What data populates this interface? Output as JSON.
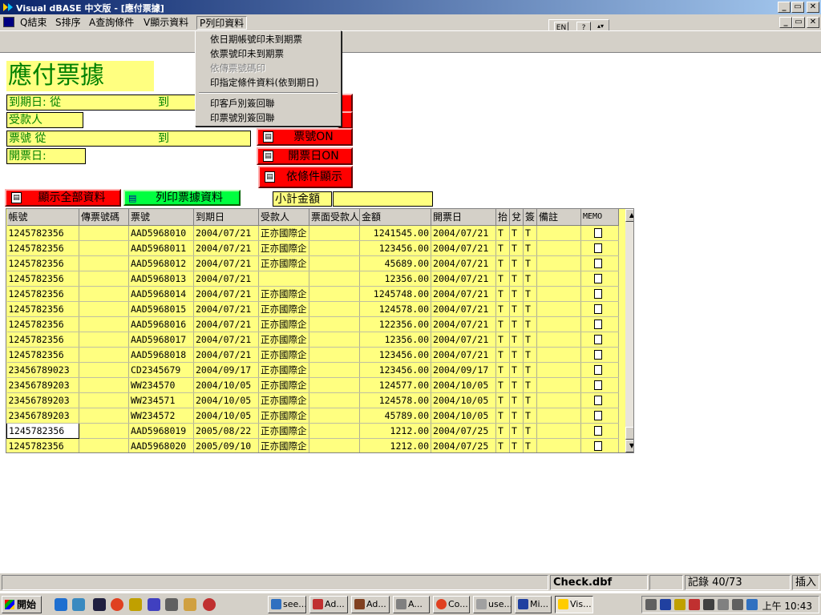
{
  "window": {
    "title": "Visual dBASE 中文版 - [應付票據]"
  },
  "menubar": {
    "items": [
      {
        "label": "Q結束"
      },
      {
        "label": "S排序"
      },
      {
        "label": "A查詢條件"
      },
      {
        "label": "V顯示資料"
      },
      {
        "label": "P列印資料"
      }
    ]
  },
  "toolbar": {
    "lang_btn": "EN",
    "help_btn": "?"
  },
  "print_menu": {
    "items": [
      {
        "label": "依日期帳號印未到期票",
        "enabled": true
      },
      {
        "label": "依票號印未到期票",
        "enabled": true
      },
      {
        "label": "依傳票號碼印",
        "enabled": false
      },
      {
        "label": "印指定條件資料(依到期日)",
        "enabled": true
      },
      {
        "label": "印客戶別簽回聯",
        "enabled": true
      },
      {
        "label": "印票號別簽回聯",
        "enabled": true
      }
    ]
  },
  "form": {
    "title": "應付票據",
    "due_date_label": "到期日: 從",
    "due_date_to": "到",
    "payee_label": "受款人",
    "ticket_no_label": "票號 從",
    "ticket_no_to": "到",
    "issue_date_label": "開票日:",
    "btn_ticket_on": "票號ON",
    "btn_issue_on": "開票日ON",
    "btn_by_condition": "依條件顯示",
    "btn_show_all": "顯示全部資料",
    "btn_print": "列印票據資料",
    "subtotal_label": "小計金額",
    "subtotal_value": ""
  },
  "grid": {
    "columns": [
      "帳號",
      "傳票號碼",
      "票號",
      "到期日",
      "受款人",
      "票面受款人",
      "金額",
      "開票日",
      "抬",
      "兌",
      "簽",
      "備註",
      "MEMO"
    ],
    "rows": [
      {
        "account": "1245782356",
        "voucher": "",
        "ticket": "AAD5968010",
        "due": "2004/07/21",
        "payee": "正亦國際企",
        "face_payee": "",
        "amount": "1241545.00",
        "issue": "2004/07/21",
        "a": "T",
        "b": "T",
        "c": "T",
        "note": ""
      },
      {
        "account": "1245782356",
        "voucher": "",
        "ticket": "AAD5968011",
        "due": "2004/07/21",
        "payee": "正亦國際企",
        "face_payee": "",
        "amount": "123456.00",
        "issue": "2004/07/21",
        "a": "T",
        "b": "T",
        "c": "T",
        "note": ""
      },
      {
        "account": "1245782356",
        "voucher": "",
        "ticket": "AAD5968012",
        "due": "2004/07/21",
        "payee": "正亦國際企",
        "face_payee": "",
        "amount": "45689.00",
        "issue": "2004/07/21",
        "a": "T",
        "b": "T",
        "c": "T",
        "note": ""
      },
      {
        "account": "1245782356",
        "voucher": "",
        "ticket": "AAD5968013",
        "due": "2004/07/21",
        "payee": "",
        "face_payee": "",
        "amount": "12356.00",
        "issue": "2004/07/21",
        "a": "T",
        "b": "T",
        "c": "T",
        "note": ""
      },
      {
        "account": "1245782356",
        "voucher": "",
        "ticket": "AAD5968014",
        "due": "2004/07/21",
        "payee": "正亦國際企",
        "face_payee": "",
        "amount": "1245748.00",
        "issue": "2004/07/21",
        "a": "T",
        "b": "T",
        "c": "T",
        "note": ""
      },
      {
        "account": "1245782356",
        "voucher": "",
        "ticket": "AAD5968015",
        "due": "2004/07/21",
        "payee": "正亦國際企",
        "face_payee": "",
        "amount": "124578.00",
        "issue": "2004/07/21",
        "a": "T",
        "b": "T",
        "c": "T",
        "note": ""
      },
      {
        "account": "1245782356",
        "voucher": "",
        "ticket": "AAD5968016",
        "due": "2004/07/21",
        "payee": "正亦國際企",
        "face_payee": "",
        "amount": "122356.00",
        "issue": "2004/07/21",
        "a": "T",
        "b": "T",
        "c": "T",
        "note": ""
      },
      {
        "account": "1245782356",
        "voucher": "",
        "ticket": "AAD5968017",
        "due": "2004/07/21",
        "payee": "正亦國際企",
        "face_payee": "",
        "amount": "12356.00",
        "issue": "2004/07/21",
        "a": "T",
        "b": "T",
        "c": "T",
        "note": ""
      },
      {
        "account": "1245782356",
        "voucher": "",
        "ticket": "AAD5968018",
        "due": "2004/07/21",
        "payee": "正亦國際企",
        "face_payee": "",
        "amount": "123456.00",
        "issue": "2004/07/21",
        "a": "T",
        "b": "T",
        "c": "T",
        "note": ""
      },
      {
        "account": "23456789023",
        "voucher": "",
        "ticket": "CD2345679",
        "due": "2004/09/17",
        "payee": "正亦國際企",
        "face_payee": "",
        "amount": "123456.00",
        "issue": "2004/09/17",
        "a": "T",
        "b": "T",
        "c": "T",
        "note": ""
      },
      {
        "account": "23456789203",
        "voucher": "",
        "ticket": "WW234570",
        "due": "2004/10/05",
        "payee": "正亦國際企",
        "face_payee": "",
        "amount": "124577.00",
        "issue": "2004/10/05",
        "a": "T",
        "b": "T",
        "c": "T",
        "note": ""
      },
      {
        "account": "23456789203",
        "voucher": "",
        "ticket": "WW234571",
        "due": "2004/10/05",
        "payee": "正亦國際企",
        "face_payee": "",
        "amount": "124578.00",
        "issue": "2004/10/05",
        "a": "T",
        "b": "T",
        "c": "T",
        "note": ""
      },
      {
        "account": "23456789203",
        "voucher": "",
        "ticket": "WW234572",
        "due": "2004/10/05",
        "payee": "正亦國際企",
        "face_payee": "",
        "amount": "45789.00",
        "issue": "2004/10/05",
        "a": "T",
        "b": "T",
        "c": "T",
        "note": ""
      },
      {
        "account": "1245782356",
        "voucher": "",
        "ticket": "AAD5968019",
        "due": "2005/08/22",
        "payee": "正亦國際企",
        "face_payee": "",
        "amount": "1212.00",
        "issue": "2004/07/25",
        "a": "T",
        "b": "T",
        "c": "T",
        "note": "",
        "selected": true
      },
      {
        "account": "1245782356",
        "voucher": "",
        "ticket": "AAD5968020",
        "due": "2005/09/10",
        "payee": "正亦國際企",
        "face_payee": "",
        "amount": "1212.00",
        "issue": "2004/07/25",
        "a": "T",
        "b": "T",
        "c": "T",
        "note": ""
      }
    ]
  },
  "statusbar": {
    "file": "Check.dbf",
    "record": "記錄 40/73",
    "mode": "插入"
  },
  "taskbar": {
    "start": "開始",
    "tasks": [
      {
        "label": "see..."
      },
      {
        "label": "Ad..."
      },
      {
        "label": "Ad..."
      },
      {
        "label": "A..."
      },
      {
        "label": "Co..."
      },
      {
        "label": "use..."
      },
      {
        "label": "Mi..."
      },
      {
        "label": "Vis..."
      }
    ],
    "clock": "上午 10:43"
  }
}
